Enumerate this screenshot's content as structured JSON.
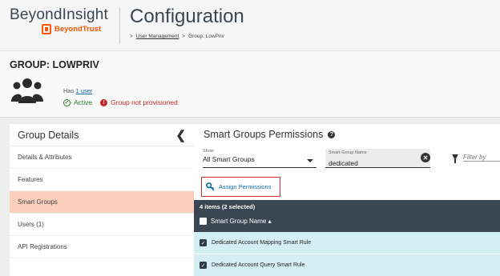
{
  "header": {
    "product_name": "BeyondInsight",
    "vendor": "BeyondTrust",
    "page_title": "Configuration",
    "breadcrumb": {
      "sep1": ">",
      "item1": "User Management",
      "sep2": ">",
      "item2": "Group: LowPriv"
    }
  },
  "group": {
    "title": "GROUP: LOWPRIV",
    "has_prefix": "Has",
    "user_link": "1 user",
    "status_active": "Active",
    "status_warning": "Group not provisioned"
  },
  "leftnav": {
    "title": "Group Details",
    "items": [
      {
        "label": "Details & Attributes",
        "active": false
      },
      {
        "label": "Features",
        "active": false
      },
      {
        "label": "Smart Groups",
        "active": true
      },
      {
        "label": "Users (1)",
        "active": false
      },
      {
        "label": "API Registrations",
        "active": false
      }
    ]
  },
  "panel": {
    "title": "Smart Groups Permissions",
    "show_label": "Show",
    "show_value": "All Smart Groups",
    "sgname_label": "Smart Group Name",
    "sgname_value": "dedicated",
    "filter_placeholder": "Filter by",
    "assign_label": "Assign Permissions",
    "items_count": "4 items (2 selected)",
    "column_header": "Smart Group Name ▴",
    "rows": [
      {
        "label": "Dedicated Account Mapping Smart Rule",
        "checked": true
      },
      {
        "label": "Dedicated Account Query Smart Rule",
        "checked": true
      }
    ]
  },
  "colors": {
    "accent": "#ff5500",
    "active_nav": "#fbd0bb",
    "grid_header": "#3a4651",
    "row_bg": "#d4eef4",
    "link": "#0b6aa8",
    "error": "#c62828",
    "success": "#2e7d32"
  },
  "icons": {
    "vendor_logo": "beyondtrust-logo",
    "avatar": "users-group-icon",
    "active": "check-circle-icon",
    "warning": "exclamation-circle-icon",
    "collapse": "chevron-left-icon",
    "help": "help-icon",
    "clear": "clear-icon",
    "filter": "filter-icon",
    "assign": "key-icon"
  }
}
